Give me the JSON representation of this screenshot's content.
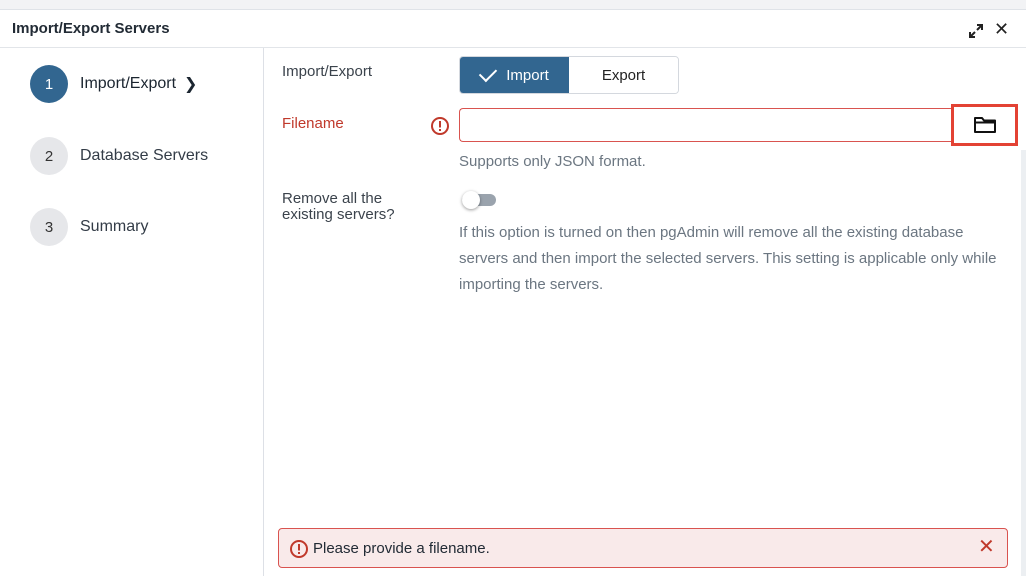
{
  "dialog": {
    "title": "Import/Export Servers",
    "expand_icon": "expand-icon",
    "close_icon": "close-icon",
    "close_glyph": "✕"
  },
  "steps": [
    {
      "number": "1",
      "label": "Import/Export",
      "active": true,
      "chevron": "❯"
    },
    {
      "number": "2",
      "label": "Database Servers",
      "active": false
    },
    {
      "number": "3",
      "label": "Summary",
      "active": false
    }
  ],
  "form": {
    "import_export": {
      "label": "Import/Export",
      "options": [
        "Import",
        "Export"
      ],
      "selected": "Import"
    },
    "filename": {
      "label": "Filename",
      "value": "",
      "help": "Supports only JSON format.",
      "error_icon": "warning-circle-icon",
      "browse_icon": "folder-icon"
    },
    "remove_servers": {
      "label_line1": "Remove all the",
      "label_line2": "existing servers?",
      "enabled": false,
      "description": "If this option is turned on then pgAdmin will remove all the existing database servers and then import the selected servers. This setting is applicable only while importing the servers."
    }
  },
  "alert": {
    "message": "Please provide a filename.",
    "close_glyph": "✕",
    "icon": "warning-circle-icon"
  },
  "colors": {
    "primary": "#326690",
    "error": "#d9534f",
    "highlight": "#e34234"
  }
}
